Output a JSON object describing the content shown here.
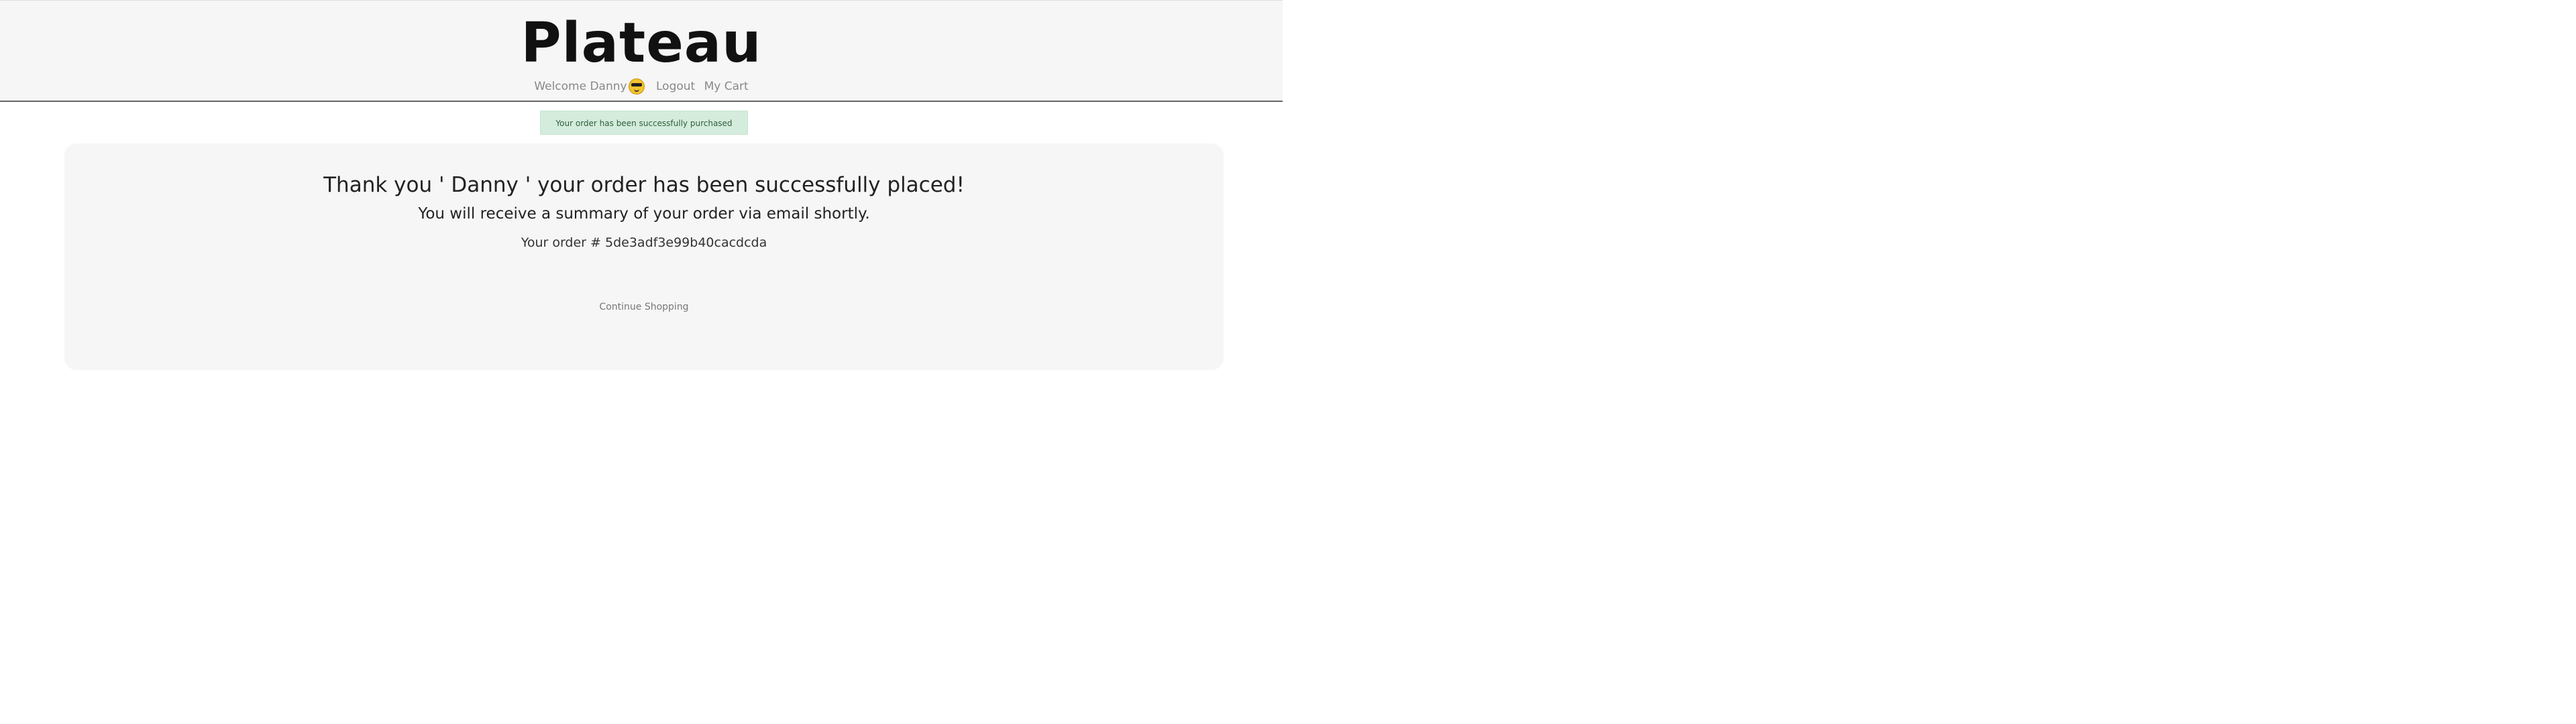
{
  "header": {
    "brand": "Plateau",
    "welcome_text": "Welcome Danny",
    "logout_label": "Logout",
    "cart_label": "My Cart"
  },
  "icons": {
    "user_emoji": "sunglasses-face-icon"
  },
  "alert": {
    "message": "Your order has been successfully purchased"
  },
  "confirmation": {
    "thanks": "Thank you ' Danny ' your order has been successfully placed!",
    "summary": "You will receive a summary of your order via email shortly.",
    "order_line": "Your order # 5de3adf3e99b40cacdcda",
    "continue_label": "Continue Shopping"
  },
  "colors": {
    "header_bg": "#f6f6f6",
    "alert_bg": "#d4ecdb",
    "alert_text": "#2f5f3b",
    "card_bg": "#f6f6f6"
  }
}
